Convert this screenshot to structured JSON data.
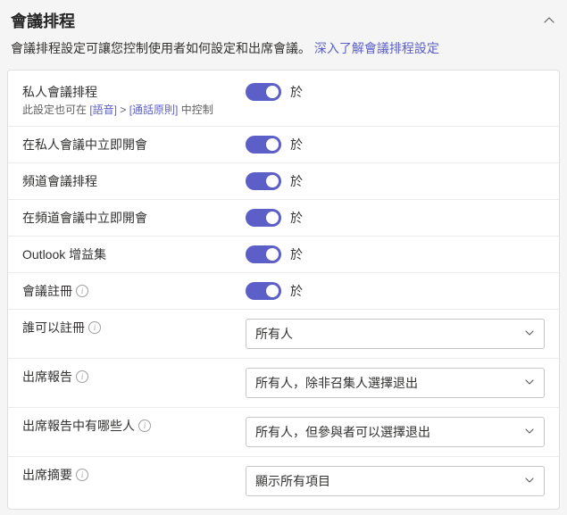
{
  "header": {
    "title": "會議排程"
  },
  "description": {
    "text": "會議排程設定可讓您控制使用者如何設定和出席會議。",
    "link": "深入了解會議排程設定"
  },
  "toggle_state_label": "於",
  "rows": {
    "private_meeting": {
      "label": "私人會議排程",
      "sub_prefix": "此設定也可在 ",
      "sub_link1": "[語音]",
      "sub_sep": " > ",
      "sub_link2": "[通話原則]",
      "sub_suffix": " 中控制"
    },
    "meet_now_private": {
      "label": "在私人會議中立即開會"
    },
    "channel_meeting": {
      "label": "頻道會議排程"
    },
    "meet_now_channel": {
      "label": "在頻道會議中立即開會"
    },
    "outlook_addin": {
      "label": "Outlook 增益集"
    },
    "meeting_registration": {
      "label": "會議註冊"
    },
    "who_can_register": {
      "label": "誰可以註冊",
      "value": "所有人"
    },
    "attendance_report": {
      "label": "出席報告",
      "value": "所有人，除非召集人選擇退出"
    },
    "who_in_report": {
      "label": "出席報告中有哪些人",
      "value": "所有人，但參與者可以選擇退出"
    },
    "attendance_summary": {
      "label": "出席摘要",
      "value": "顯示所有項目"
    }
  }
}
